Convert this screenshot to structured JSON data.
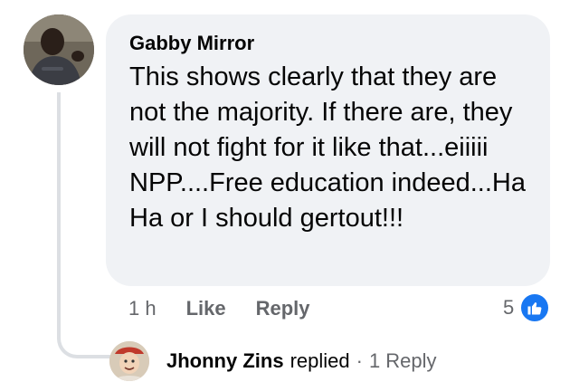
{
  "comment": {
    "author": "Gabby Mirror",
    "text": "This shows clearly that they are not the majority. If there are, they will not fight for it like that...eiiiii NPP....Free education indeed...Ha Ha or I should gertout!!!",
    "avatar_icon": "profile-photo-man",
    "timestamp": "1 h",
    "like_label": "Like",
    "reply_label": "Reply",
    "reaction_count": "5",
    "reaction_icon": "thumbs-up-icon",
    "reaction_color": "#1877f2"
  },
  "replies_summary": {
    "avatar_icon": "profile-photo-replier",
    "name": "Jhonny Zins",
    "verb": "replied",
    "separator": "·",
    "count_label": "1 Reply"
  },
  "colors": {
    "bubble_bg": "#f0f2f5",
    "text_primary": "#050505",
    "text_secondary": "#65676b",
    "thread_line": "#dcdfe3"
  }
}
